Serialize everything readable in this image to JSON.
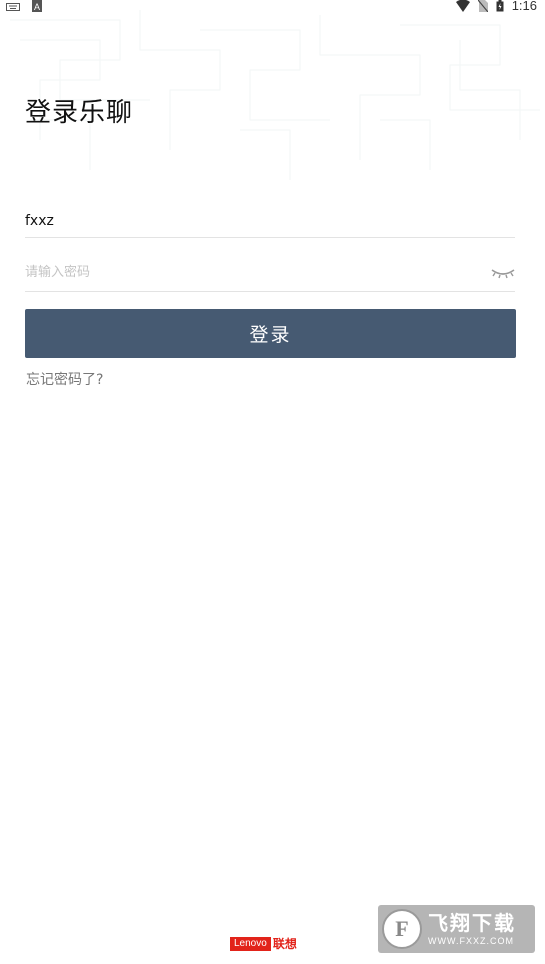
{
  "status_bar": {
    "time": "1:16",
    "icons": [
      "keyboard-icon",
      "a-icon",
      "wifi-icon",
      "no-sim-icon",
      "battery-icon"
    ]
  },
  "login": {
    "title": "登录乐聊",
    "username_value": "fxxz",
    "password_placeholder": "请输入密码",
    "password_value": "",
    "login_button": "登录",
    "forgot_link": "忘记密码了?"
  },
  "footer": {
    "brand_en": "Lenovo",
    "brand_cn": "联想"
  },
  "watermark": {
    "title": "飞翔下载",
    "url": "WWW.FXXZ.COM"
  },
  "colors": {
    "button": "#465a72",
    "brand": "#e2231a"
  }
}
